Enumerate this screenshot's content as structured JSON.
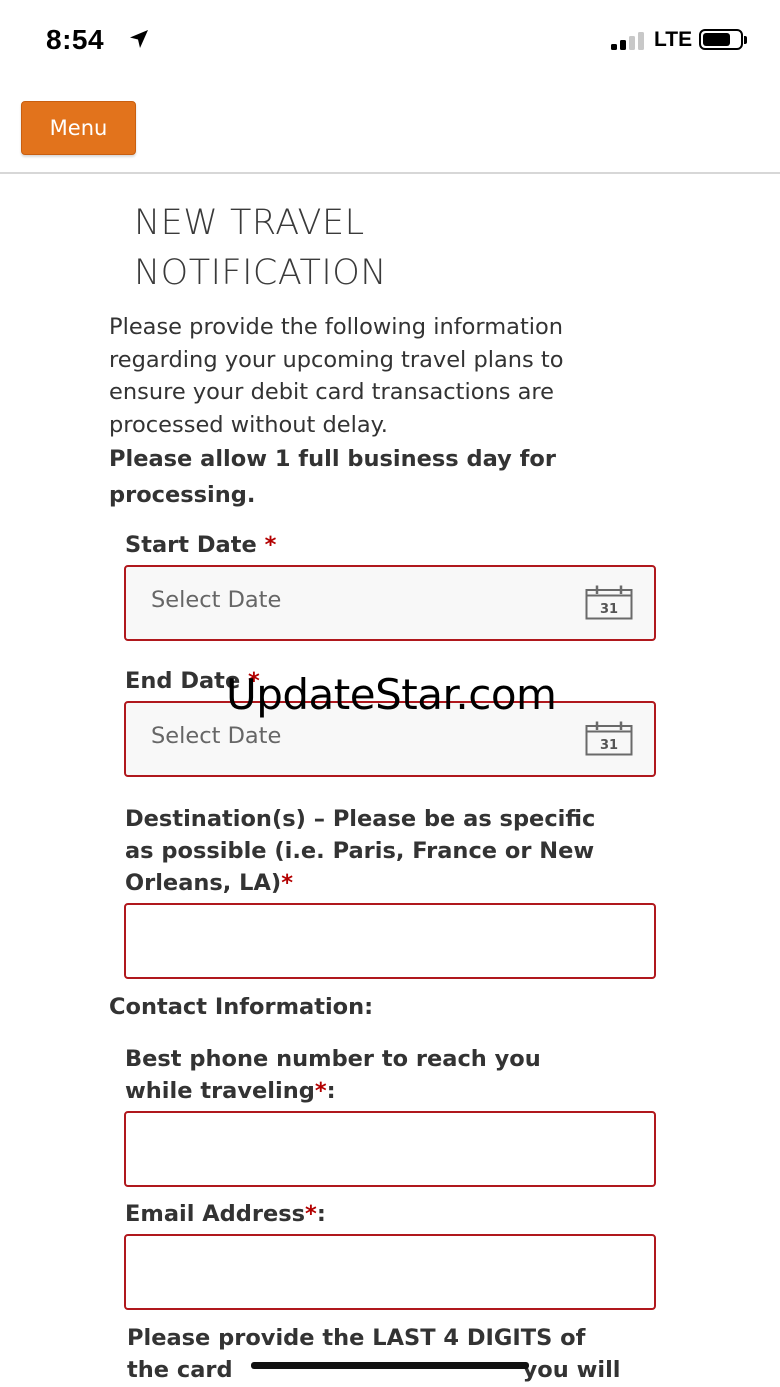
{
  "status_bar": {
    "time": "8:54",
    "network": "LTE"
  },
  "header": {
    "menu_label": "Menu",
    "accent_color": "#e2731c"
  },
  "page": {
    "title_line1": "NEW TRAVEL",
    "title_line2": "NOTIFICATION",
    "intro_line1": "Please provide the following information",
    "intro_line2": "regarding your upcoming travel plans to",
    "intro_line3": "ensure your debit card transactions are",
    "intro_line4": "processed without delay.",
    "bold_line1": "Please allow 1 full business day for",
    "bold_line2": "processing."
  },
  "form": {
    "required_marker": "*",
    "start_date": {
      "label": "Start Date",
      "placeholder": "Select Date",
      "calendar_day": "31"
    },
    "end_date": {
      "label": "End Date",
      "placeholder": "Select Date",
      "calendar_day": "31"
    },
    "destination": {
      "label_line1": "Destination(s) – Please be as specific",
      "label_line2": "as possible (i.e. Paris, France or New",
      "label_line3": "Orleans, LA)"
    },
    "contact_heading": "Contact Information:",
    "phone": {
      "label_line1": "Best phone number to reach you",
      "label_line2": "while traveling",
      "label_suffix": ":"
    },
    "email": {
      "label": "Email Address",
      "label_suffix": ":"
    },
    "card_digits": {
      "label_line1": "Please provide the LAST 4 DIGITS of",
      "label_line2_start": "the card",
      "label_line2_end": "you will"
    },
    "error_border_color": "#b0181d"
  },
  "watermark": "UpdateStar.com"
}
